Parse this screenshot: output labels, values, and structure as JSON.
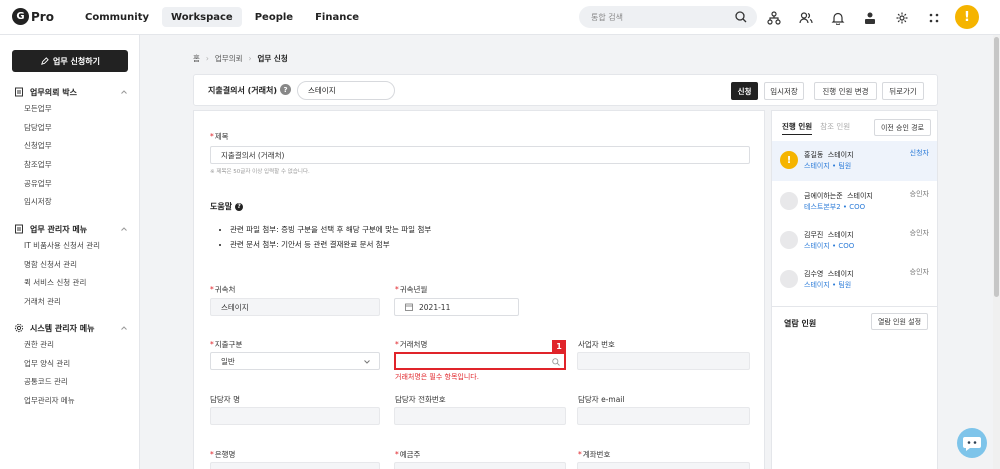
{
  "app": {
    "logo_letter": "G",
    "logo_text": "Pro"
  },
  "nav": [
    "Community",
    "Workspace",
    "People",
    "Finance"
  ],
  "search": {
    "placeholder": "통합 검색"
  },
  "top_avatar": "!",
  "sidebar": {
    "new_button": "업무 신청하기",
    "groups": [
      {
        "title": "업무의뢰 박스",
        "icon": "document-icon",
        "items": [
          "모든업무",
          "담당업무",
          "신청업무",
          "참조업무",
          "공유업무",
          "임시저장"
        ]
      },
      {
        "title": "업무 관리자 메뉴",
        "icon": "document-icon",
        "items": [
          "IT 비품사용 신청서 관리",
          "명함 신청서 관리",
          "퀵 서비스 신청 관리",
          "거래처 관리"
        ]
      },
      {
        "title": "시스템 관리자 메뉴",
        "icon": "gear-icon",
        "items": [
          "권한 관리",
          "업무 양식 관리",
          "공통코드 관리",
          "업무관리자 메뉴"
        ]
      }
    ]
  },
  "breadcrumb": [
    "홈",
    "업무의뢰",
    "업무 신청"
  ],
  "header": {
    "doc_title": "지출결의서 (거래처)",
    "help": "?",
    "org": "스테이지",
    "buttons": [
      "신청",
      "임시저장",
      "진행 인원 변경",
      "뒤로가기"
    ]
  },
  "form": {
    "title_label": "제목",
    "title_value": "지출결의서 (거래처)",
    "title_note": "※ 제목은 50글자 이상 입력할 수 없습니다.",
    "help_title": "도움말",
    "help_icon": "?",
    "bullets": [
      "관련 파일 첨부: 증빙 구분을 선택 후 해당 구분에 맞는 파일 첨부",
      "관련 문서 첨부: 기안서 등 관련 결재완료 문서 첨부"
    ],
    "affiliation_label": "귀속처",
    "affiliation_value": "스테이지",
    "period_label": "귀속년월",
    "period_value": "2021-11",
    "expense_type_label": "지출구분",
    "expense_type_value": "일반",
    "vendor_label": "거래처명",
    "vendor_value": "",
    "vendor_error": "거래처명은 필수 항목입니다.",
    "error_badge": "1",
    "business_no_label": "사업자 번호",
    "contact_name_label": "담당자 명",
    "contact_phone_label": "담당자 전화번호",
    "contact_email_label": "담당자 e-mail",
    "bank_label": "은행명",
    "depositor_label": "예금주",
    "account_label": "계좌번호",
    "required_mark": "*"
  },
  "panel": {
    "tabs": [
      "진행 인원",
      "참조 인원"
    ],
    "prev_route_button": "이전 승인 경로",
    "approvers": [
      {
        "name": "홍길동",
        "org": "스테이지",
        "dept": "스테이지 • 팀원",
        "role": "신청자"
      },
      {
        "name": "금에이하는준",
        "org": "스테이지",
        "dept": "테스트본부2 • COO",
        "role": "승인자"
      },
      {
        "name": "김무진",
        "org": "스테이지",
        "dept": "스테이지 • COO",
        "role": "승인자"
      },
      {
        "name": "김수영",
        "org": "스테이지",
        "dept": "스테이지 • 팀원",
        "role": "승인자"
      }
    ],
    "warn_mark": "!",
    "viewer_title": "열람 인원",
    "viewer_button": "열람 인원 설정"
  }
}
